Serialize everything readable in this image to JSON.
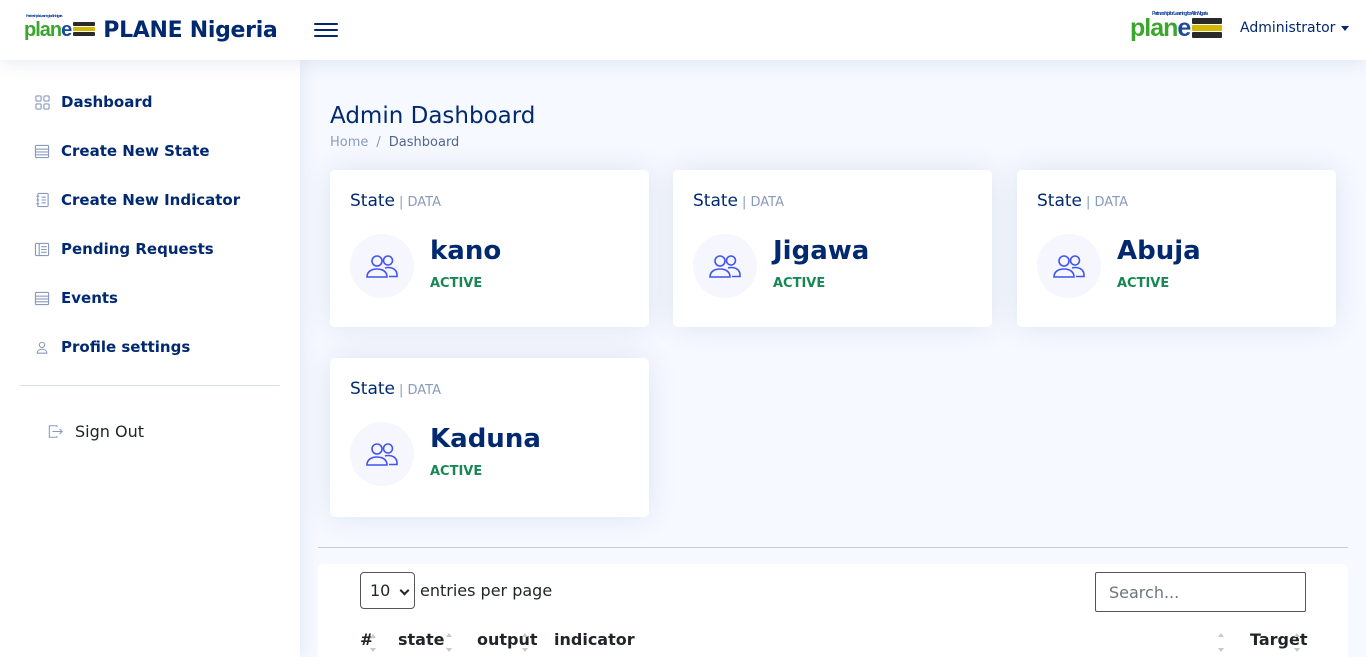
{
  "header": {
    "logo_text": "plane",
    "logo_tagline": "Partnership for Learning for All in Nigeria",
    "brand": "PLANE Nigeria",
    "user": "Administrator"
  },
  "sidebar": {
    "items": [
      {
        "label": "Dashboard",
        "icon": "grid-icon"
      },
      {
        "label": "Create New State",
        "icon": "list-icon"
      },
      {
        "label": "Create New Indicator",
        "icon": "journal-icon"
      },
      {
        "label": "Pending Requests",
        "icon": "layout-icon"
      },
      {
        "label": "Events",
        "icon": "list-icon"
      },
      {
        "label": "Profile settings",
        "icon": "person-icon"
      }
    ],
    "signout": "Sign Out"
  },
  "page": {
    "title": "Admin Dashboard",
    "breadcrumb": [
      "Home",
      "/",
      "Dashboard"
    ]
  },
  "cards": [
    {
      "title": "State",
      "sub": "| DATA",
      "name": "kano",
      "status": "ACTIVE"
    },
    {
      "title": "State",
      "sub": "| DATA",
      "name": "Jigawa",
      "status": "ACTIVE"
    },
    {
      "title": "State",
      "sub": "| DATA",
      "name": "Abuja",
      "status": "ACTIVE"
    },
    {
      "title": "State",
      "sub": "| DATA",
      "name": "Kaduna",
      "status": "ACTIVE"
    }
  ],
  "table": {
    "page_size": "10",
    "entries_label": "entries per page",
    "search_placeholder": "Search...",
    "columns": [
      "#",
      "state",
      "output",
      "indicator",
      "Target"
    ]
  },
  "colors": {
    "primary": "#012970",
    "accent": "#4154f1",
    "status_active": "#198754",
    "background": "#f6f9ff"
  }
}
